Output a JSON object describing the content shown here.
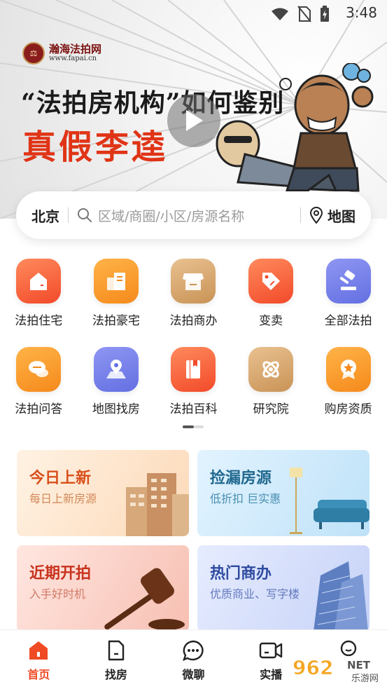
{
  "status_bar": {
    "time": "3:48",
    "icons": [
      "wifi-icon",
      "no-sim-icon",
      "battery-charging-icon"
    ]
  },
  "banner": {
    "logo_name": "瀚海法拍网",
    "logo_url": "www.fapai.cn",
    "headline": "“法拍房机构”如何鉴别",
    "subline": "真假李逵",
    "play_icon": "play-icon"
  },
  "search": {
    "city": "北京",
    "placeholder": "区域/商圈/小区/房源名称",
    "map_label": "地图"
  },
  "grid": {
    "row1": [
      {
        "label": "法拍住宅",
        "icon": "house-icon",
        "color": "#f24a2a"
      },
      {
        "label": "法拍豪宅",
        "icon": "villa-icon",
        "color": "#f58a1c"
      },
      {
        "label": "法拍商办",
        "icon": "store-icon",
        "color": "#c99356"
      },
      {
        "label": "变卖",
        "icon": "tag-icon",
        "color": "#f24a2a"
      },
      {
        "label": "全部法拍",
        "icon": "gavel-icon",
        "color": "#6470e2"
      }
    ],
    "row2": [
      {
        "label": "法拍问答",
        "icon": "chat-icon",
        "color": "#f58a1c"
      },
      {
        "label": "地图找房",
        "icon": "map-pin-icon",
        "color": "#6470e2"
      },
      {
        "label": "法拍百科",
        "icon": "book-icon",
        "color": "#f24a2a"
      },
      {
        "label": "研究院",
        "icon": "atom-icon",
        "color": "#c99356"
      },
      {
        "label": "购房资质",
        "icon": "badge-icon",
        "color": "#f58a1c"
      }
    ]
  },
  "cards": [
    {
      "title": "今日上新",
      "subtitle": "每日上新房源"
    },
    {
      "title": "捡漏房源",
      "subtitle": "低折扣 巨实惠"
    },
    {
      "title": "近期开拍",
      "subtitle": "入手好时机"
    },
    {
      "title": "热门商办",
      "subtitle": "优质商业、写字楼"
    }
  ],
  "tabbar": [
    {
      "label": "首页",
      "icon": "home-icon",
      "active": true
    },
    {
      "label": "找房",
      "icon": "find-house-icon",
      "active": false
    },
    {
      "label": "微聊",
      "icon": "chat-bubble-icon",
      "active": false
    },
    {
      "label": "实播",
      "icon": "video-camera-icon",
      "active": false
    },
    {
      "label": "",
      "icon": "profile-icon",
      "active": false
    }
  ],
  "watermark": {
    "text": "962",
    "suffix": "NET",
    "caption": "乐游网"
  },
  "colors": {
    "accent": "#f04a24",
    "headline_red": "#e03416"
  }
}
